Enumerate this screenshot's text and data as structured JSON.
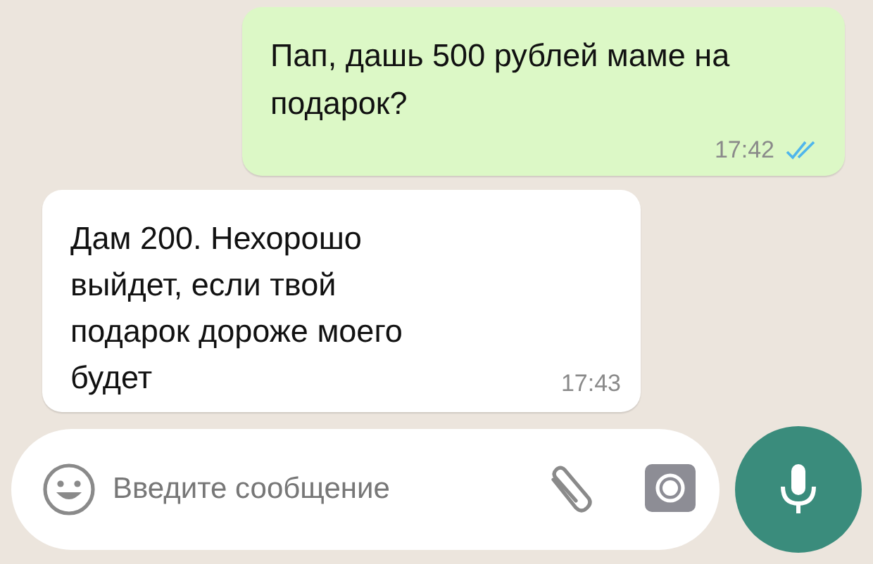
{
  "messages": [
    {
      "kind": "outgoing",
      "text": "Пап, дашь 500 рублей маме на подарок?",
      "time": "17:42",
      "read": true
    },
    {
      "kind": "incoming",
      "text": "Дам 200. Нехорошо выйдет, если твой подарок дороже моего будет",
      "time": "17:43"
    }
  ],
  "composer": {
    "placeholder": "Введите сообщение"
  }
}
